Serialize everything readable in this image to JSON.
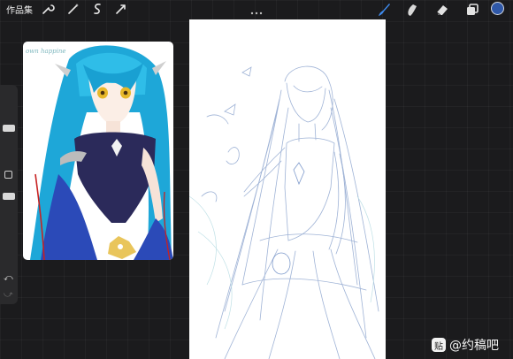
{
  "app": {
    "gallery_label": "作品集"
  },
  "top_toolbar": {
    "left_icons": [
      "wrench-icon",
      "magic-wand-icon",
      "selection-icon",
      "transform-icon"
    ],
    "right_tools": [
      "brush-icon",
      "smudge-icon",
      "eraser-icon",
      "layers-icon"
    ],
    "active_tool": "brush-icon",
    "current_color": "#2f58a8"
  },
  "sidebar": {
    "undo_glyph": "⤺",
    "redo_glyph": "⤻"
  },
  "reference_window": {
    "caption": "own happine"
  },
  "watermark": {
    "logo_glyph": "贴",
    "text": "@约稿吧"
  }
}
